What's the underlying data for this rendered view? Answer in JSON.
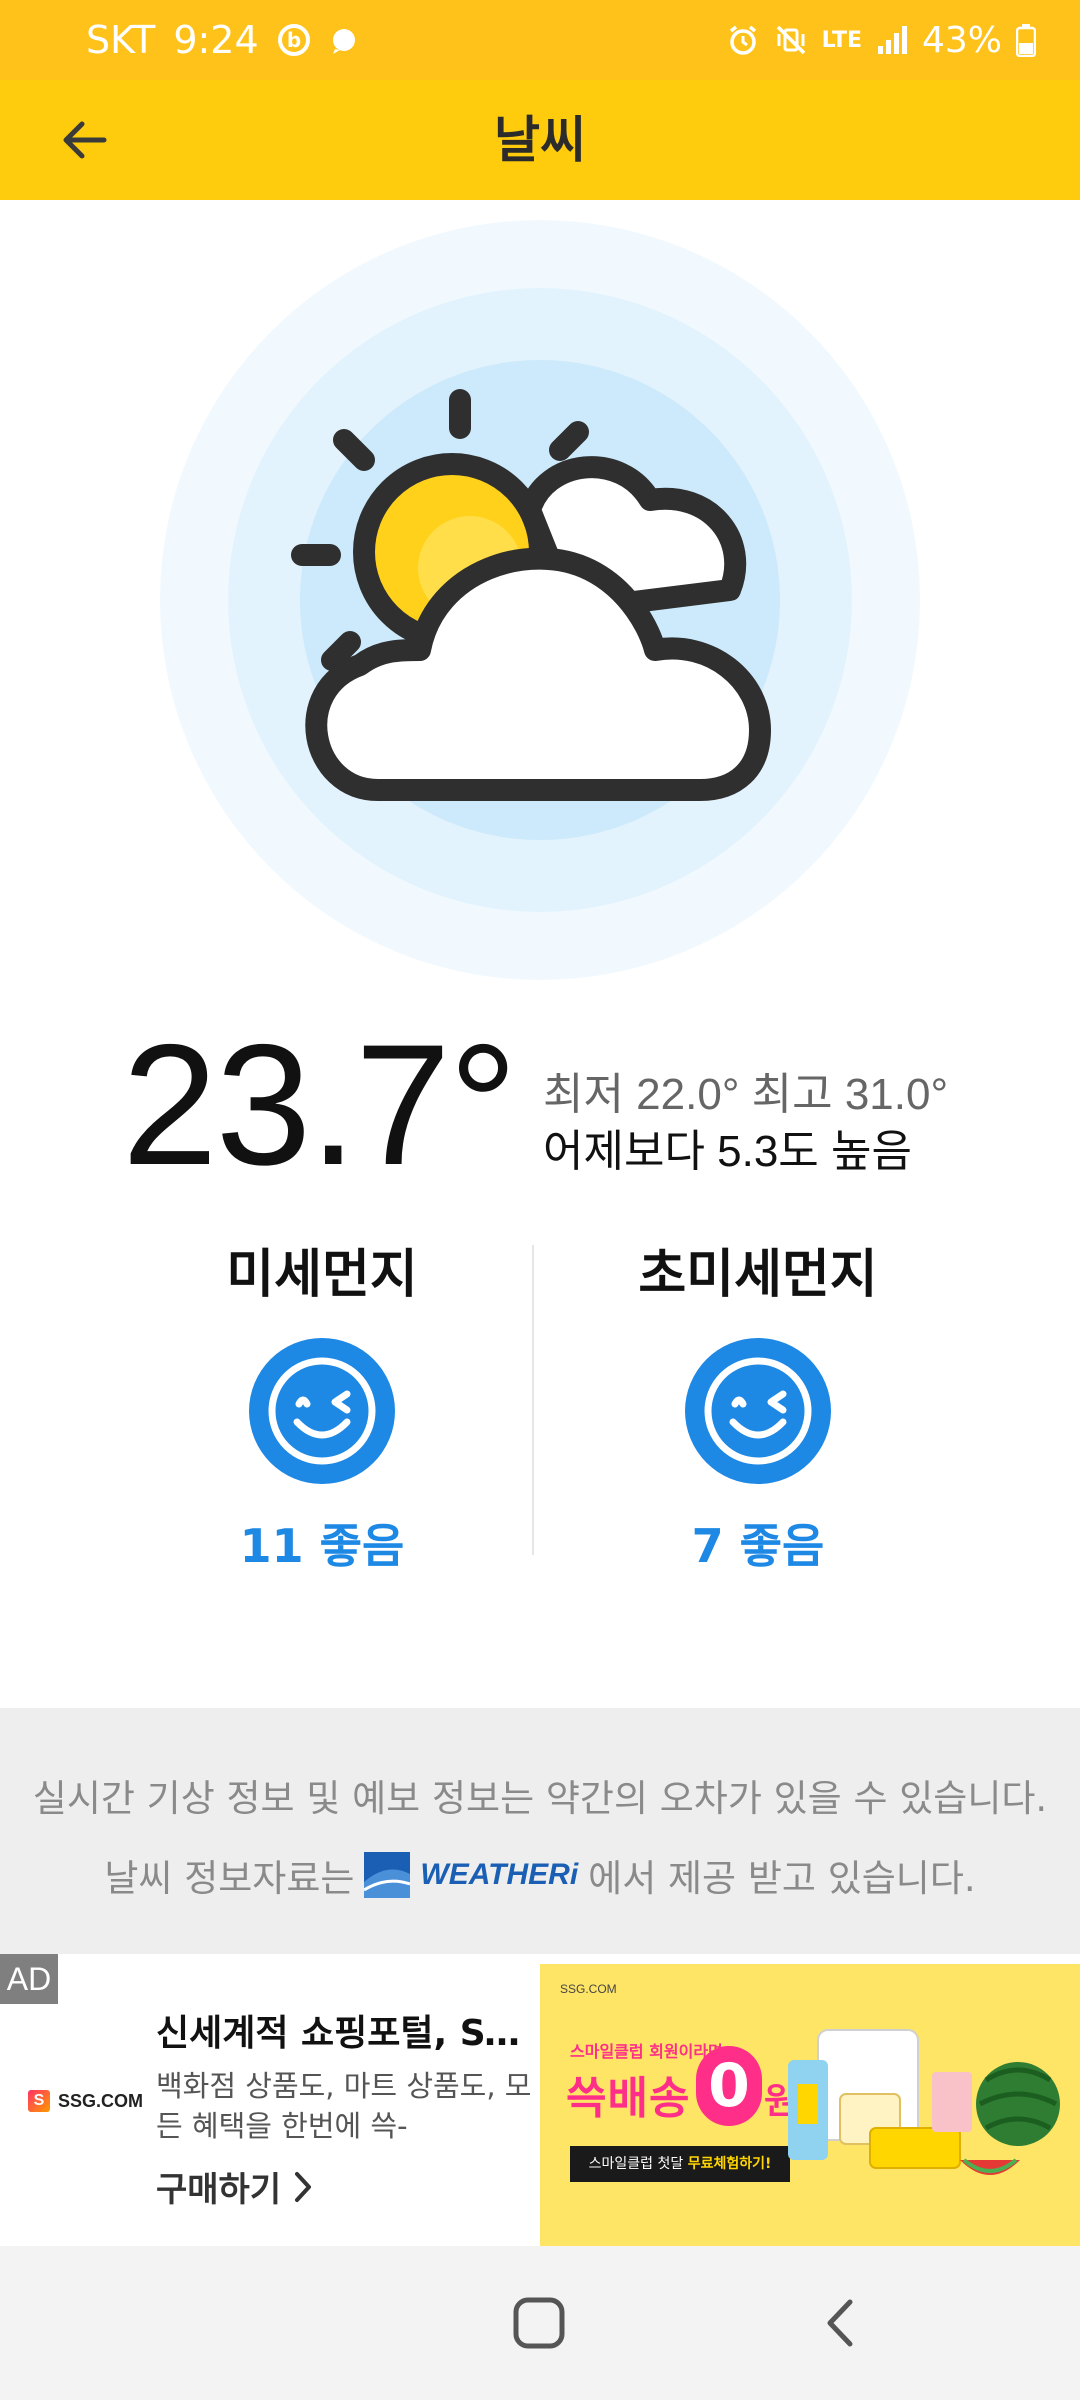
{
  "status_bar": {
    "carrier": "SKT",
    "time": "9:24",
    "network": "LTE",
    "battery": "43%",
    "icons": [
      "b-app-icon",
      "bubble-icon",
      "alarm-icon",
      "vibrate-mute-icon",
      "lte-icon",
      "signal-icon",
      "battery-icon"
    ]
  },
  "app_bar": {
    "title": "날씨",
    "back_icon": "arrow-left-icon"
  },
  "weather": {
    "icon": "partly-cloudy-icon",
    "temperature": "23.7°",
    "min_max": "최저 22.0° 최고 31.0°",
    "compare": "어제보다 5.3도 높음"
  },
  "air_quality": {
    "fine_dust": {
      "title": "미세먼지",
      "value": "11 좋음",
      "face_icon": "smile-wink-icon"
    },
    "ultrafine_dust": {
      "title": "초미세먼지",
      "value": "7 좋음",
      "face_icon": "smile-wink-icon"
    },
    "good_color": "#1e88e5"
  },
  "info": {
    "line1": "실시간 기상 정보 및 예보 정보는 약간의 오차가 있을 수 있습니다.",
    "line2_prefix": "날씨 정보자료는",
    "provider": "WEATHERi",
    "line2_suffix": "에서 제공 받고 있습니다."
  },
  "ad": {
    "badge": "AD",
    "brand": "SSG.COM",
    "title": "신세계적 쇼핑포털, SS...",
    "description": "백화점 상품도, 마트 상품도, 모든 혜택을 한번에 쓱-",
    "cta": "구매하기",
    "banner": {
      "brand": "SSG.COM",
      "subtitle": "스마일클럽 회원이라면",
      "main": "쓱배송",
      "zero": "0",
      "won": "원",
      "cta_prefix": "스마일클럽 첫달",
      "cta_highlight": "무료체험하기!"
    }
  },
  "nav": {
    "home_icon": "home-square-icon",
    "back_icon": "back-chevron-icon"
  },
  "colors": {
    "status_bar": "#ffc21a",
    "app_bar": "#ffcc0d",
    "accent_blue": "#1e88e5"
  }
}
